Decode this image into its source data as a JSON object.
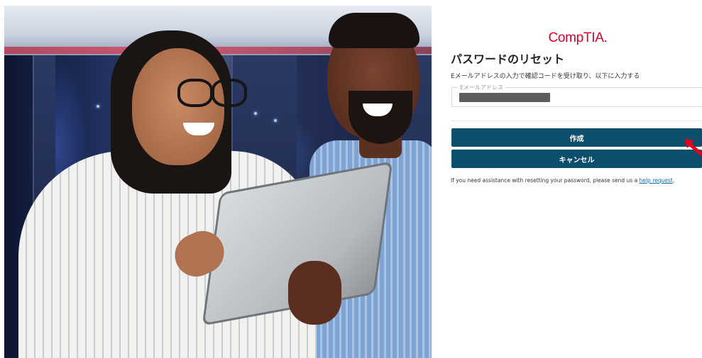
{
  "logo": {
    "text": "CompTIA."
  },
  "page": {
    "title": "パスワードのリセット",
    "instructions": "Eメールアドレスの入力で確認コードを受け取り、以下に入力する"
  },
  "email_field": {
    "label": "Eメールアドレス",
    "value_redacted": true
  },
  "buttons": {
    "create": "作成",
    "cancel": "キャンセル"
  },
  "help": {
    "text": "If you need assistance with resetting your password, please send us a ",
    "link": "help request",
    "suffix": "."
  },
  "colors": {
    "brand_red": "#d9002c",
    "button_bg": "#0b4f6c",
    "link": "#0b6aa8",
    "arrow": "#e2001a"
  },
  "icons": {
    "annotation": "red-arrow-icon"
  }
}
